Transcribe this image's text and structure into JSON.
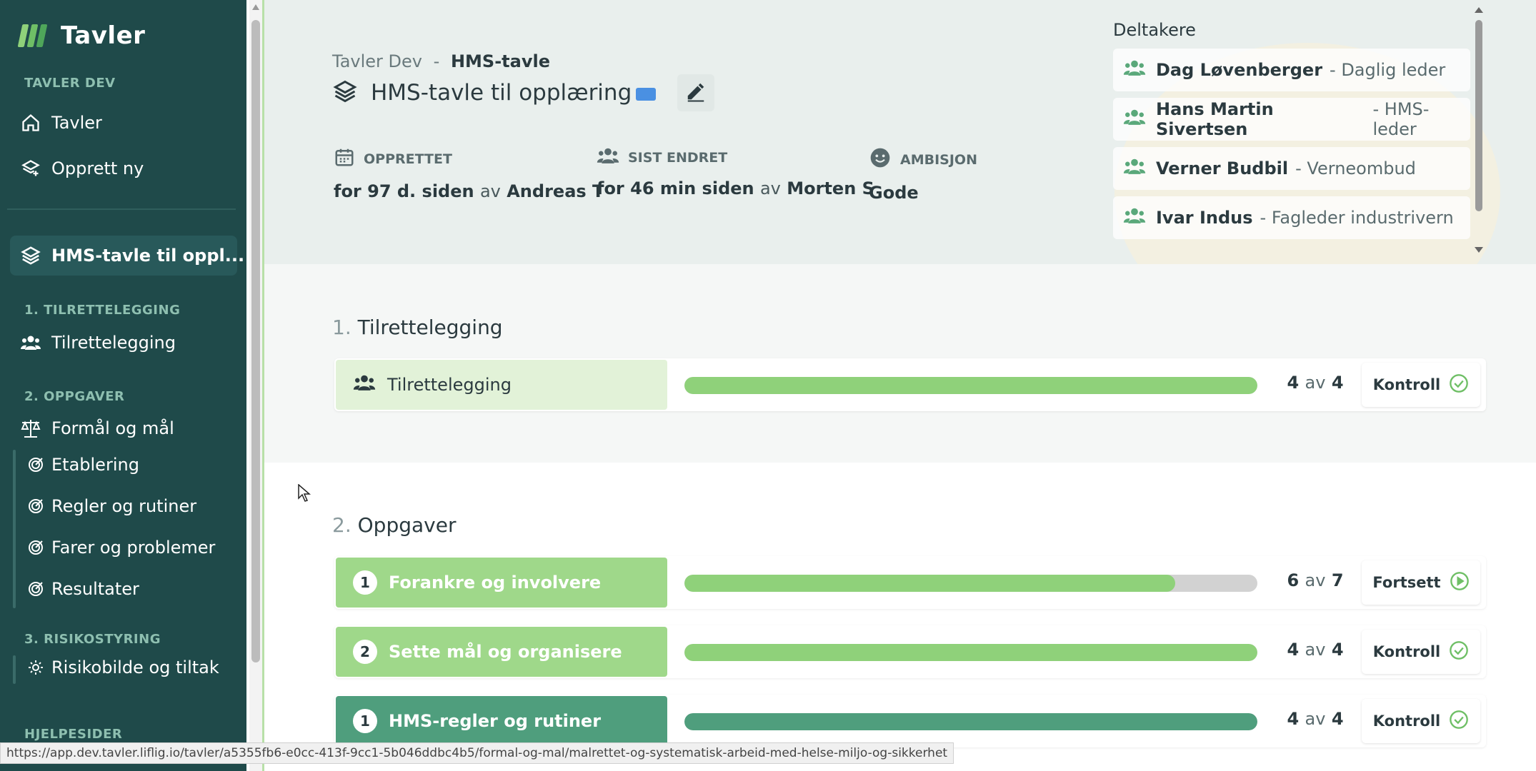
{
  "app": {
    "name": "Tavler"
  },
  "sidebar": {
    "org_label": "TAVLER DEV",
    "nav": [
      {
        "label": "Tavler",
        "icon": "home-icon"
      },
      {
        "label": "Opprett ny",
        "icon": "add-board-icon"
      }
    ],
    "active_board": "HMS-tavle til oppl...",
    "sections": [
      {
        "label": "1. TILRETTELEGGING",
        "items": [
          {
            "label": "Tilrettelegging",
            "icon": "users-icon"
          }
        ]
      },
      {
        "label": "2. OPPGAVER",
        "items": [
          {
            "label": "Formål og mål",
            "icon": "scales-icon"
          },
          {
            "label": "Etablering",
            "icon": "target-icon"
          },
          {
            "label": "Regler og rutiner",
            "icon": "target-icon"
          },
          {
            "label": "Farer og problemer",
            "icon": "target-icon"
          },
          {
            "label": "Resultater",
            "icon": "target-icon"
          }
        ]
      },
      {
        "label": "3. RISIKOSTYRING",
        "items": [
          {
            "label": "Risikobilde og tiltak",
            "icon": "sun-icon"
          }
        ]
      },
      {
        "label": "HJELPESIDER",
        "items": []
      }
    ]
  },
  "header": {
    "breadcrumb": {
      "org": "Tavler Dev",
      "separator": "-",
      "board": "HMS-tavle"
    },
    "title": "HMS-tavle til opplæring",
    "meta": [
      {
        "label": "OPPRETTET",
        "prefix": "for 97 d. siden",
        "by": "av",
        "name": "Andreas T",
        "icon": "calendar-icon"
      },
      {
        "label": "SIST ENDRET",
        "prefix": "for 46 min siden",
        "by": "av",
        "name": "Morten S",
        "icon": "users-icon"
      },
      {
        "label": "AMBISJON",
        "value": "Gode",
        "icon": "smiley-icon"
      }
    ]
  },
  "participants": {
    "title": "Deltakere",
    "items": [
      {
        "name": "Dag Løvenberger",
        "role": "Daglig leder"
      },
      {
        "name": "Hans Martin Sivertsen",
        "role": "HMS-leder"
      },
      {
        "name": "Verner Budbil",
        "role": "Verneombud"
      },
      {
        "name": "Ivar Indus",
        "role": "Fagleder industrivern"
      }
    ]
  },
  "sections": [
    {
      "num": "1.",
      "title": "Tilrettelegging",
      "rows": [
        {
          "label": "Tilrettelegging",
          "done": 4,
          "total": 4,
          "of": "av",
          "button": "Kontroll",
          "button_icon": "check-circle-icon",
          "progress": 1.0
        }
      ]
    },
    {
      "num": "2.",
      "title": "Oppgaver",
      "rows": [
        {
          "index": "1",
          "label": "Forankre og involvere",
          "done": 6,
          "total": 7,
          "of": "av",
          "button": "Fortsett",
          "button_icon": "play-circle-icon",
          "progress": 0.857
        },
        {
          "index": "2",
          "label": "Sette mål og organisere",
          "done": 4,
          "total": 4,
          "of": "av",
          "button": "Kontroll",
          "button_icon": "check-circle-icon",
          "progress": 1.0
        },
        {
          "index": "1",
          "label": "HMS-regler og rutiner",
          "done": 4,
          "total": 4,
          "of": "av",
          "button": "Kontroll",
          "button_icon": "check-circle-icon",
          "progress": 1.0
        }
      ]
    }
  ],
  "statusbar": {
    "url": "https://app.dev.tavler.liflig.io/tavler/a5355fb6-e0cc-413f-9cc1-5b046ddbc4b5/formal-og-mal/malrettet-og-systematisk-arbeid-med-helse-miljo-og-sikkerhet"
  },
  "colors": {
    "sidebar_bg": "#1f4a4a",
    "accent_green": "#8fd17a",
    "task_light": "#9fd88a",
    "task_dark": "#4f9e7d",
    "header_bg": "#e9efed"
  }
}
